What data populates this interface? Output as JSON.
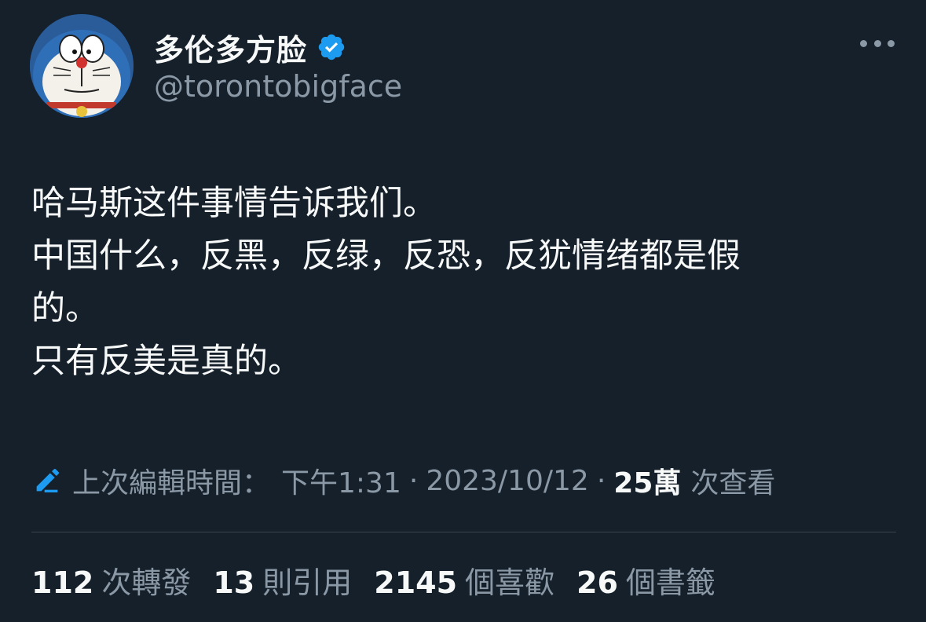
{
  "user": {
    "display_name": "多伦多方脸",
    "handle": "@torontobigface",
    "avatar_icon": "doraemon-avatar",
    "verified_icon": "verified-badge-icon"
  },
  "menu": {
    "more_icon": "more-horizontal-icon"
  },
  "tweet": {
    "lines": [
      "哈马斯这件事情告诉我们。",
      "中国什么，反黑，反绿，反恐，反犹情绪都是假",
      "的。",
      "只有反美是真的。"
    ]
  },
  "meta": {
    "edit_icon": "edit-pencil-icon",
    "edited_label": "上次編輯時間：",
    "time": "下午1:31",
    "separator": "·",
    "date": "2023/10/12",
    "views_count": "25萬",
    "views_label": "次查看"
  },
  "stats": [
    {
      "count": "112",
      "label": "次轉發"
    },
    {
      "count": "13",
      "label": "則引用"
    },
    {
      "count": "2145",
      "label": "個喜歡"
    },
    {
      "count": "26",
      "label": "個書籤"
    }
  ],
  "colors": {
    "background": "#15202b",
    "text": "#f7f9f9",
    "secondary": "#8b98a5",
    "accent": "#1d9bf0",
    "divider": "#38444d"
  }
}
